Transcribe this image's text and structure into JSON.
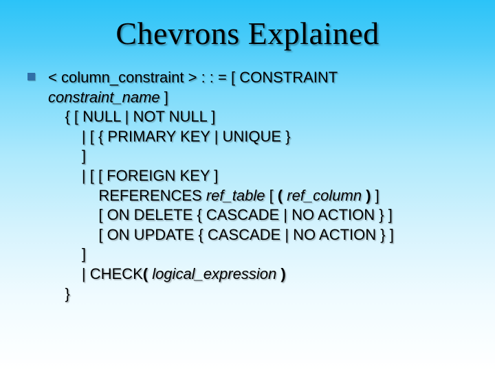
{
  "title": "Chevrons Explained",
  "lines": {
    "0": {
      "a": "< column_constraint > : : = [ CONSTRAINT"
    },
    "1": {
      "a": "constraint_name",
      "b": " ]"
    },
    "2": {
      "a": "    { [ NULL | NOT NULL ]"
    },
    "3": {
      "a": "        | [ { PRIMARY KEY | UNIQUE }"
    },
    "4": {
      "a": "        ]"
    },
    "5": {
      "a": "        | [ [ FOREIGN KEY ]"
    },
    "6": {
      "a": "            REFERENCES ",
      "b": "ref_table",
      "c": " [ ",
      "d": "(",
      "e": " ",
      "f": "ref_column",
      "g": " ",
      "h": ")",
      "i": " ]"
    },
    "7": {
      "a": "            [ ON DELETE { CASCADE | NO ACTION } ]"
    },
    "8": {
      "a": "            [ ON UPDATE { CASCADE | NO ACTION } ]"
    },
    "9": {
      "a": "        ]"
    },
    "10": {
      "a": "        | CHECK",
      "b": "(",
      "c": " ",
      "d": "logical_expression",
      "e": " ",
      "f": ")"
    },
    "11": {
      "a": "    }"
    }
  }
}
